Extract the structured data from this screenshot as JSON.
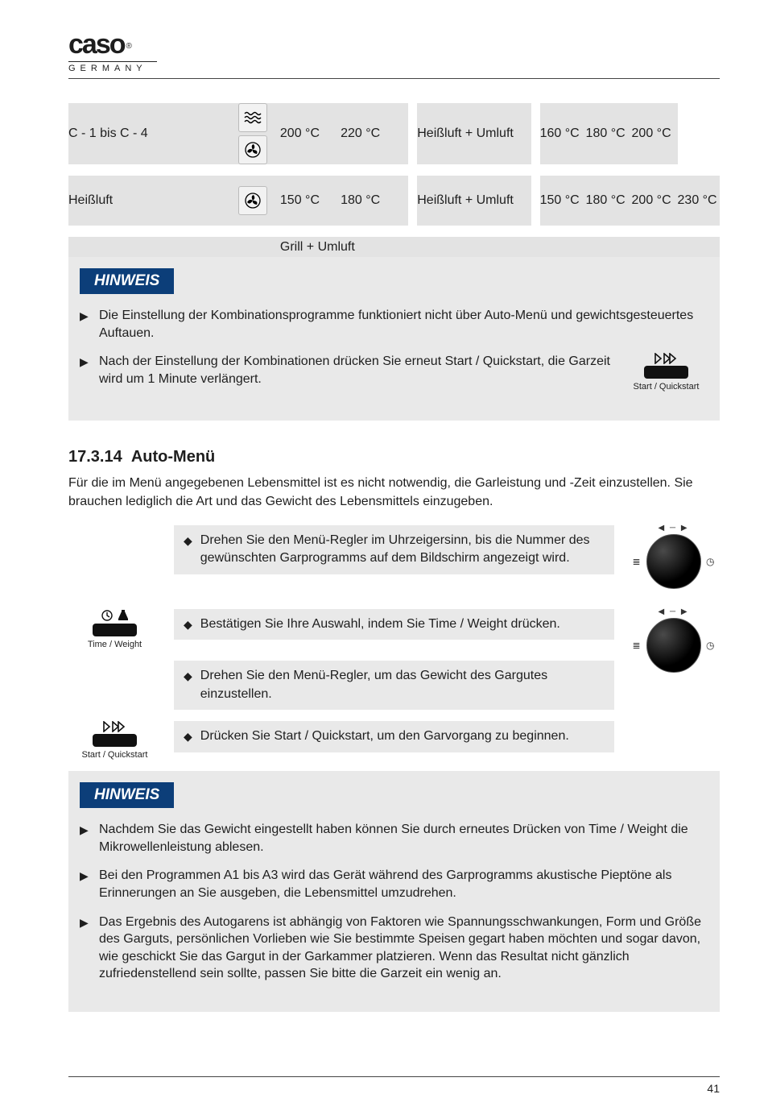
{
  "brand": {
    "name": "caso",
    "trade": "®",
    "sub": "GERMANY"
  },
  "table": {
    "row1": {
      "label": "C - 1 bis C - 4",
      "seg1": "200 °C",
      "seg2": "220 °C",
      "seg3": "Heißluft + Umluft",
      "seg4": "160 °C",
      "seg5": "180 °C",
      "seg6": "200 °C"
    },
    "row2": {
      "label": "Heißluft",
      "seg1": "150 °C",
      "seg2": "180 °C",
      "seg3": "Heißluft + Umluft",
      "seg4": "150 °C",
      "seg5": "180 °C",
      "seg6": "200 °C",
      "seg7": "230 °C"
    },
    "row3": {
      "label": "",
      "val": "Grill + Umluft"
    }
  },
  "buttons": {
    "start": "Start / Quickstart",
    "timeweight": "Time / Weight"
  },
  "hinweis_label": "HINWEIS",
  "notes1": {
    "a": "Die Einstellung der Kombinationsprogramme funktioniert nicht über Auto-Menü und gewichtsgesteuertes Auftauen.",
    "b": "Nach der Einstellung der Kombinationen drücken Sie erneut Start / Quickstart, die Garzeit wird um 1 Minute verlängert."
  },
  "section": {
    "num": "17.3.14",
    "title": "Auto-Menü",
    "intro": "Für die im Menü angegebenen Lebensmittel ist es nicht notwendig, die Garleistung und -Zeit einzustellen. Sie brauchen lediglich die Art und das Gewicht des Lebensmittels einzugeben.",
    "step1": "Drehen Sie den Menü-Regler im Uhrzeigersinn, bis die Nummer des gewünschten Garprogramms auf dem Bildschirm angezeigt wird.",
    "step2a": "Bestätigen Sie Ihre Auswahl, indem Sie Time / Weight drücken.",
    "step2b": "Drehen Sie den Menü-Regler, um das Gewicht des Gargutes einzustellen.",
    "step3": "Drücken Sie Start / Quickstart, um den Garvorgang zu beginnen."
  },
  "notes2": {
    "a": "Nachdem Sie das Gewicht eingestellt haben können Sie durch erneutes Drücken von Time / Weight die Mikrowellenleistung ablesen.",
    "b": "Bei den Programmen A1 bis A3 wird das Gerät während des Garprogramms akustische Pieptöne als Erinnerungen an Sie ausgeben, die Lebensmittel umzudrehen.",
    "c": "Das Ergebnis des Autogarens ist abhängig von Faktoren wie Spannungsschwankungen, Form und Größe des Garguts, persönlichen Vorlieben wie Sie bestimmte Speisen gegart haben möchten und sogar davon, wie geschickt Sie das Gargut in der Garkammer platzieren. Wenn das Resultat nicht gänzlich zufriedenstellend sein sollte, passen Sie bitte die Garzeit ein wenig an."
  },
  "page_number": "41"
}
